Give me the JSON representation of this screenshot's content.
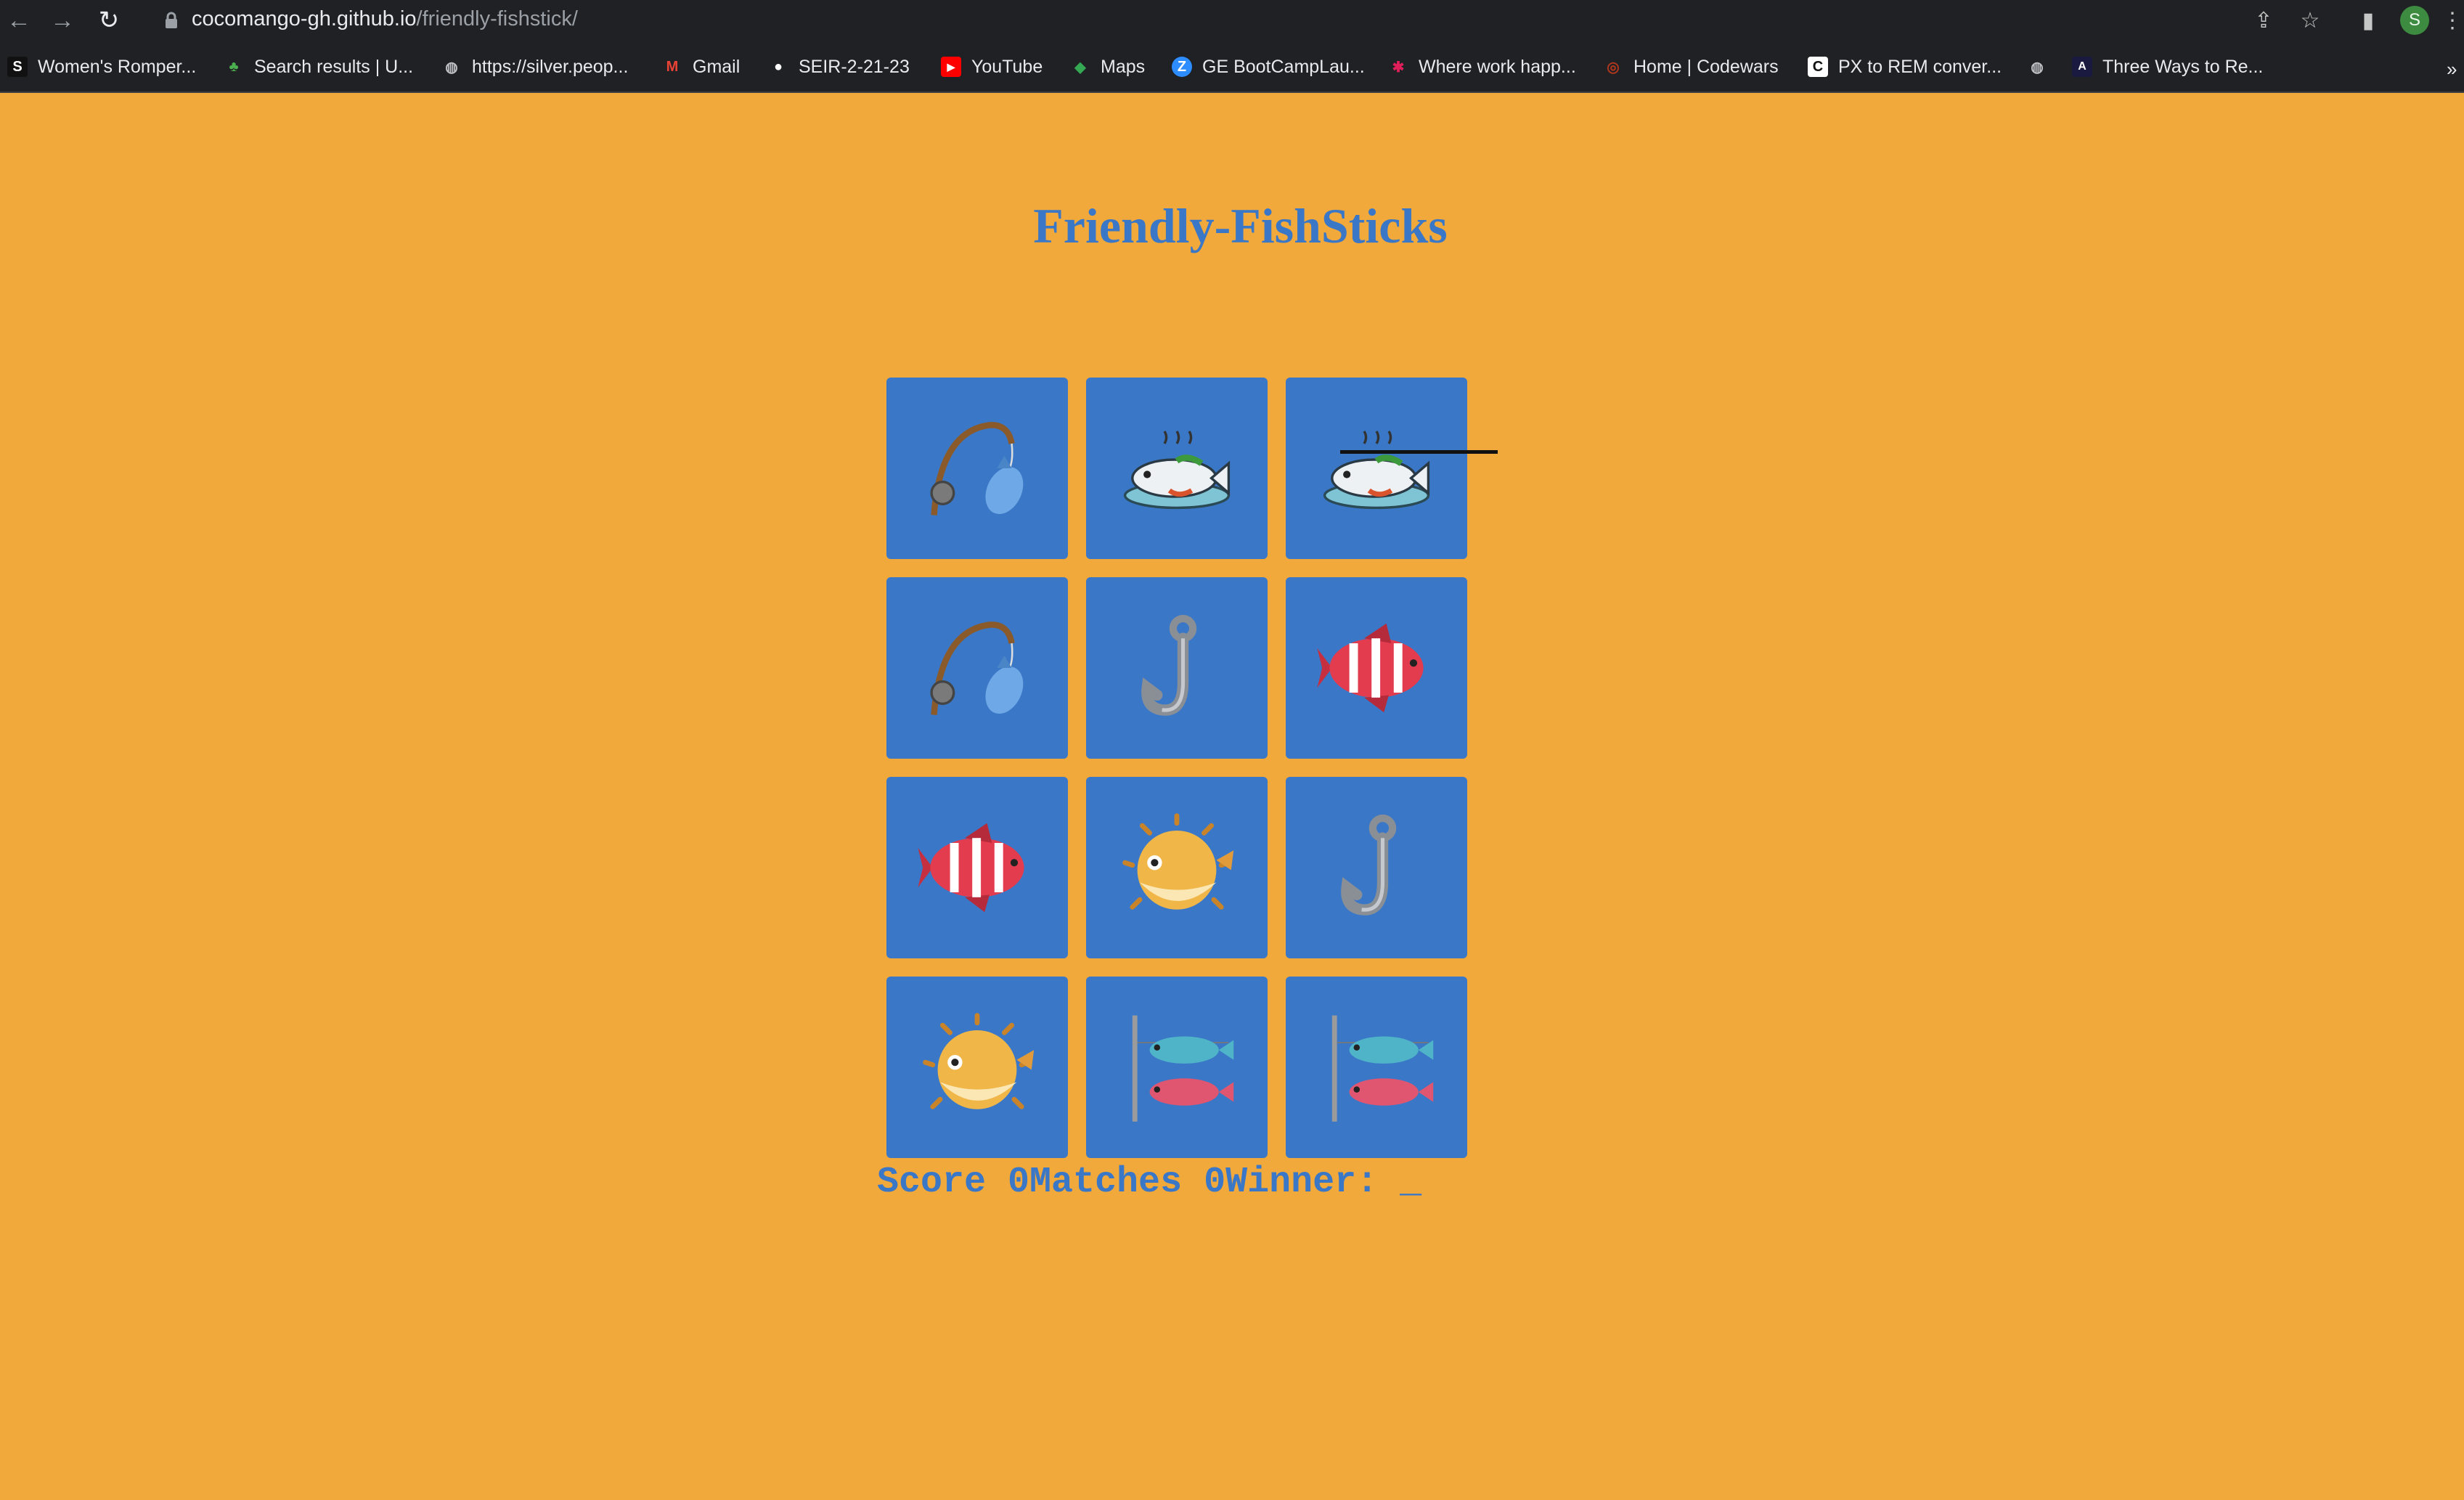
{
  "browser": {
    "url_host": "cocomango-gh.github.io",
    "url_path": "/friendly-fishstick/",
    "profile_initial": "S",
    "bookmarks": [
      {
        "label": "Women's Romper...",
        "icon": "s-icon"
      },
      {
        "label": "Search results | U...",
        "icon": "plant-icon"
      },
      {
        "label": "https://silver.peop...",
        "icon": "globe-icon"
      },
      {
        "label": "Gmail",
        "icon": "gmail-icon"
      },
      {
        "label": "SEIR-2-21-23",
        "icon": "github-icon"
      },
      {
        "label": "YouTube",
        "icon": "youtube-icon"
      },
      {
        "label": "Maps",
        "icon": "maps-icon"
      },
      {
        "label": "GE BootCampLau...",
        "icon": "zoom-icon"
      },
      {
        "label": "Where work happ...",
        "icon": "slack-icon"
      },
      {
        "label": "Home | Codewars",
        "icon": "codewars-icon"
      },
      {
        "label": "PX to REM conver...",
        "icon": "c-icon"
      },
      {
        "label": "",
        "icon": "globe-icon"
      },
      {
        "label": "Three Ways to Re...",
        "icon": "a-icon"
      }
    ],
    "overflow": "»"
  },
  "page": {
    "title": "Friendly-FishSticks",
    "cards": [
      "fishing-pole-icon",
      "fish-dish-icon",
      "fish-dish-icon",
      "fishing-pole-icon",
      "hook-icon",
      "tropical-fish-icon",
      "tropical-fish-icon",
      "blowfish-icon",
      "hook-icon",
      "blowfish-icon",
      "fish-rack-icon",
      "fish-rack-icon"
    ],
    "scoreline": "Score 0Matches 0Winner: _"
  }
}
